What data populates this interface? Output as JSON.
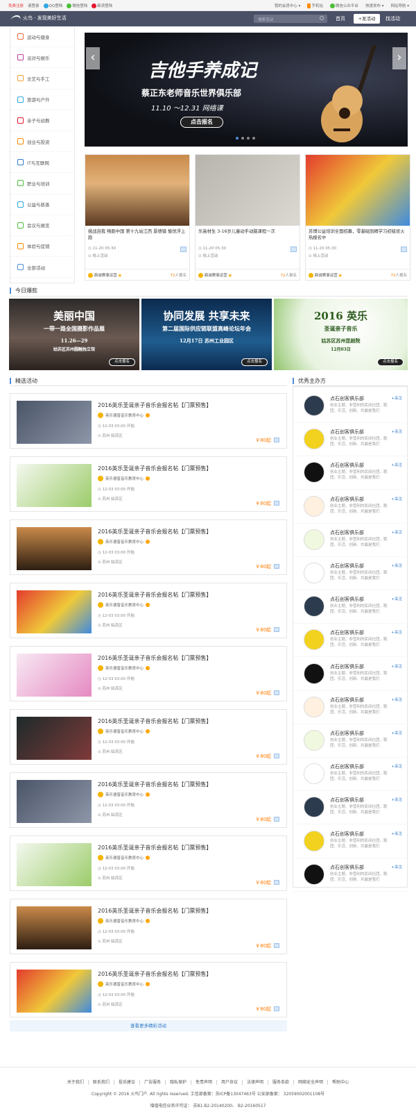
{
  "topbar": {
    "register": "免费注册",
    "login": "请登录",
    "qq_login": "QQ登陆",
    "wechat_login": "微信登陆",
    "weibo_login": "新浪登陆",
    "member_center": "我的会员中心",
    "mobile": "手机站",
    "public_account": "微信公众平台",
    "quick_publish": "快速发布",
    "site_nav": "网站导航"
  },
  "nav": {
    "logo_text": "火鸟 · 发现美好生活",
    "search_placeholder": "搜索活动",
    "home": "首页",
    "publish": "+发活动",
    "find": "找活动"
  },
  "sidebar": {
    "items": [
      "运动与健身",
      "派对与娱乐",
      "文艺与手工",
      "旅游与户外",
      "亲子与幼教",
      "创业与投资",
      "IT与互联网",
      "职业与培训",
      "公益与慈善",
      "会议与展览",
      "体验与促销",
      "全部活动"
    ]
  },
  "banner": {
    "title": "吉他手养成记",
    "subtitle": "蔡正东老师音乐世界俱乐部",
    "dates": "11.10 ～12.31   网络课",
    "button": "点击报名"
  },
  "cards": [
    {
      "title": "挑战自我 畅跑中国 第十九站江西 景德镇 愉悦浮上跑",
      "time": "11-20 05:30",
      "mode": "线上活动",
      "org": "鼎诚赛事运营",
      "count": "72",
      "count_suffix": "人报名"
    },
    {
      "title": "乐高材生 3-16岁儿童动手动脑课程一次",
      "time": "11-20 05:30",
      "mode": "线上活动",
      "org": "鼎诚赛事运营",
      "count": "72",
      "count_suffix": "人报名"
    },
    {
      "title": "苏博公益培训全面招募，零基础到精学习初级班火热报名中",
      "time": "11-20 05:30",
      "mode": "线上活动",
      "org": "鼎诚赛事运营",
      "count": "72",
      "count_suffix": "人报名"
    }
  ],
  "today_title": "今日爆款",
  "promos": [
    {
      "line1": "美丽中国",
      "line2": "一带一路全国摄影作品展",
      "line3": "11.26—29",
      "line4": "姑苏区苏州圆融独立馆",
      "button": "点击报名"
    },
    {
      "line1": "协同发展 共享未来",
      "line2": "第二届国际供应链联盟高峰论坛年会",
      "line3": "12月17日 苏州工业园区",
      "line4": "",
      "button": "点击报名"
    },
    {
      "line1": "2016 英乐",
      "line2": "圣诞亲子音乐",
      "line3": "姑苏区苏州昆剧院",
      "line4": "12月03日",
      "button": "点击报名"
    }
  ],
  "featured_title": "精选活动",
  "activities": [
    {
      "title": "2016英乐圣诞亲子音乐会报名帖【门票预售】",
      "org": "英乐德普音乐教育中心",
      "time": "12-03 03:00 开始",
      "loc": "苏州 姑苏区",
      "price": "￥80起"
    },
    {
      "title": "2016英乐圣诞亲子音乐会报名帖【门票预售】",
      "org": "英乐德普音乐教育中心",
      "time": "12-03 03:00 开始",
      "loc": "苏州 姑苏区",
      "price": "￥80起"
    },
    {
      "title": "2016英乐圣诞亲子音乐会报名帖【门票预售】",
      "org": "英乐德普音乐教育中心",
      "time": "12-03 03:00 开始",
      "loc": "苏州 姑苏区",
      "price": "￥80起"
    },
    {
      "title": "2016英乐圣诞亲子音乐会报名帖【门票预售】",
      "org": "英乐德普音乐教育中心",
      "time": "12-03 03:00 开始",
      "loc": "苏州 姑苏区",
      "price": "￥80起"
    },
    {
      "title": "2016英乐圣诞亲子音乐会报名帖【门票预售】",
      "org": "英乐德普音乐教育中心",
      "time": "12-03 03:00 开始",
      "loc": "苏州 姑苏区",
      "price": "￥80起"
    },
    {
      "title": "2016英乐圣诞亲子音乐会报名帖【门票预售】",
      "org": "英乐德普音乐教育中心",
      "time": "12-03 03:00 开始",
      "loc": "苏州 姑苏区",
      "price": "￥80起"
    },
    {
      "title": "2016英乐圣诞亲子音乐会报名帖【门票预售】",
      "org": "英乐德普音乐教育中心",
      "time": "12-03 03:00 开始",
      "loc": "苏州 姑苏区",
      "price": "￥80起"
    },
    {
      "title": "2016英乐圣诞亲子音乐会报名帖【门票预售】",
      "org": "英乐德普音乐教育中心",
      "time": "12-03 03:00 开始",
      "loc": "苏州 姑苏区",
      "price": "￥80起"
    },
    {
      "title": "2016英乐圣诞亲子音乐会报名帖【门票预售】",
      "org": "英乐德普音乐教育中心",
      "time": "12-03 03:00 开始",
      "loc": "苏州 姑苏区",
      "price": "￥80起"
    },
    {
      "title": "2016英乐圣诞亲子音乐会报名帖【门票预售】",
      "org": "英乐德普音乐教育中心",
      "time": "12-03 03:00 开始",
      "loc": "苏州 姑苏区",
      "price": "￥80起"
    }
  ],
  "more_label": "查看更多精彩活动",
  "hosts_title": "优秀主办方",
  "clubs": [
    {
      "name": "点石创客俱乐部",
      "follow": "+关注",
      "desc": "创业主题、非营利的民间社团，跑团、乐活、创新、共赢是我们"
    },
    {
      "name": "点石创客俱乐部",
      "follow": "+关注",
      "desc": "创业主题、非营利的民间社团，跑团、乐活、创新、共赢是我们"
    },
    {
      "name": "点石创客俱乐部",
      "follow": "+关注",
      "desc": "创业主题、非营利的民间社团，跑团、乐活、创新、共赢是我们"
    },
    {
      "name": "点石创客俱乐部",
      "follow": "+关注",
      "desc": "创业主题、非营利的民间社团，跑团、乐活、创新、共赢是我们"
    },
    {
      "name": "点石创客俱乐部",
      "follow": "+关注",
      "desc": "创业主题、非营利的民间社团，跑团、乐活、创新、共赢是我们"
    },
    {
      "name": "点石创客俱乐部",
      "follow": "+关注",
      "desc": "创业主题、非营利的民间社团，跑团、乐活、创新、共赢是我们"
    },
    {
      "name": "点石创客俱乐部",
      "follow": "+关注",
      "desc": "创业主题、非营利的民间社团，跑团、乐活、创新、共赢是我们"
    },
    {
      "name": "点石创客俱乐部",
      "follow": "+关注",
      "desc": "创业主题、非营利的民间社团，跑团、乐活、创新、共赢是我们"
    },
    {
      "name": "点石创客俱乐部",
      "follow": "+关注",
      "desc": "创业主题、非营利的民间社团，跑团、乐活、创新、共赢是我们"
    },
    {
      "name": "点石创客俱乐部",
      "follow": "+关注",
      "desc": "创业主题、非营利的民间社团，跑团、乐活、创新、共赢是我们"
    },
    {
      "name": "点石创客俱乐部",
      "follow": "+关注",
      "desc": "创业主题、非营利的民间社团，跑团、乐活、创新、共赢是我们"
    },
    {
      "name": "点石创客俱乐部",
      "follow": "+关注",
      "desc": "创业主题、非营利的民间社团，跑团、乐活、创新、共赢是我们"
    },
    {
      "name": "点石创客俱乐部",
      "follow": "+关注",
      "desc": "创业主题、非营利的民间社团，跑团、乐活、创新、共赢是我们"
    },
    {
      "name": "点石创客俱乐部",
      "follow": "+关注",
      "desc": "创业主题、非营利的民间社团，跑团、乐活、创新、共赢是我们"
    },
    {
      "name": "点石创客俱乐部",
      "follow": "+关注",
      "desc": "创业主题、非营利的民间社团，跑团、乐活、创新、共赢是我们"
    }
  ],
  "footer": {
    "links": [
      "关于我们",
      "联系我们",
      "投诉建议",
      "广告服务",
      "隐私保护",
      "免责声明",
      "用户协议",
      "法律声明",
      "服务条款",
      "网络安全声明",
      "帮助中心"
    ],
    "copyright": "Copyright © 2016 火鸟门户. All rights reserved. 工信部备案：苏ICP备13047463号 公安部备案： 32059002001108号",
    "license": "增值电信业务许可证：  苏B1.B2-20140200、 B2-20160517"
  },
  "colors": {
    "accent": "#4e8ed8",
    "nav_bg": "#4a5066",
    "price": "#ff7b00",
    "link": "#2d78c8"
  }
}
